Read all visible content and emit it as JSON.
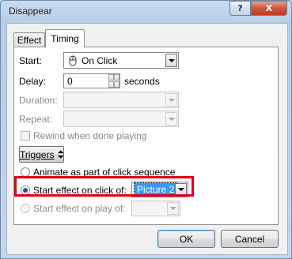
{
  "window": {
    "title": "Disappear"
  },
  "titlebar": {
    "help_label": "?",
    "close_label": "X"
  },
  "tabs": [
    {
      "label": "Effect",
      "active": false
    },
    {
      "label": "Timing",
      "active": true
    }
  ],
  "timing": {
    "start_label": "Start:",
    "start_value": "On Click",
    "start_icon": "mouse-icon",
    "delay_label": "Delay:",
    "delay_value": "0",
    "delay_unit": "seconds",
    "duration_label": "Duration:",
    "repeat_label": "Repeat:",
    "rewind_label": "Rewind when done playing",
    "triggers_label": "Triggers",
    "animate_label": "Animate as part of click sequence",
    "click_of_label": "Start effect on click of:",
    "click_of_value": "Picture 2",
    "play_of_label": "Start effect on play of:"
  },
  "buttons": {
    "ok": "OK",
    "cancel": "Cancel"
  },
  "colors": {
    "highlight_box": "#e0001b",
    "selection": "#3399ff"
  }
}
